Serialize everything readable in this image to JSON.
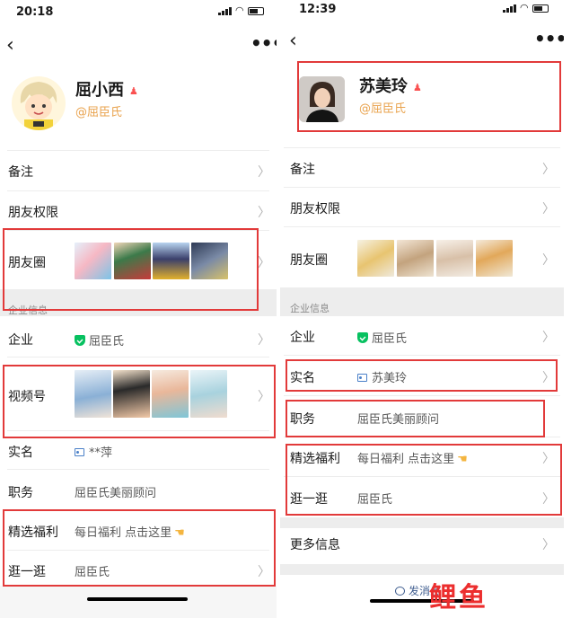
{
  "left": {
    "status_time": "20:18",
    "name": "屈小西",
    "corp": "@屈臣氏",
    "rows": {
      "beizhu": "备注",
      "quanxian": "朋友权限",
      "pyq": "朋友圈",
      "section": "企业信息",
      "qiye": "企业",
      "qiye_val": "屈臣氏",
      "shipinhao": "视频号",
      "shiming": "实名",
      "shiming_val": "**萍",
      "zhiwu": "职务",
      "zhiwu_val": "屈臣氏美丽顾问",
      "fuli": "精选福利",
      "fuli_val": "每日福利 点击这里",
      "guang": "逛一逛",
      "guang_val": "屈臣氏"
    }
  },
  "right": {
    "status_time": "12:39",
    "name": "苏美玲",
    "corp": "@屈臣氏",
    "rows": {
      "beizhu": "备注",
      "quanxian": "朋友权限",
      "pyq": "朋友圈",
      "section": "企业信息",
      "qiye": "企业",
      "qiye_val": "屈臣氏",
      "shiming": "实名",
      "shiming_val": "苏美玲",
      "zhiwu": "职务",
      "zhiwu_val": "屈臣氏美丽顾问",
      "fuli": "精选福利",
      "fuli_val": "每日福利 点击这里",
      "guang": "逛一逛",
      "guang_val": "屈臣氏",
      "more_info": "更多信息",
      "send_msg": "发消息"
    }
  },
  "watermark": "鲤鱼",
  "colors": {
    "highlight_box": "#e23a3a",
    "corp_tag": "#e9a34e",
    "verified": "#07c160",
    "watermark": "#ec2e2e"
  },
  "icons": [
    "back-chevron-icon",
    "more-dots-icon",
    "person-icon",
    "shield-check-icon",
    "id-card-icon",
    "hand-point-icon",
    "chevron-right-icon",
    "chat-bubble-icon"
  ]
}
